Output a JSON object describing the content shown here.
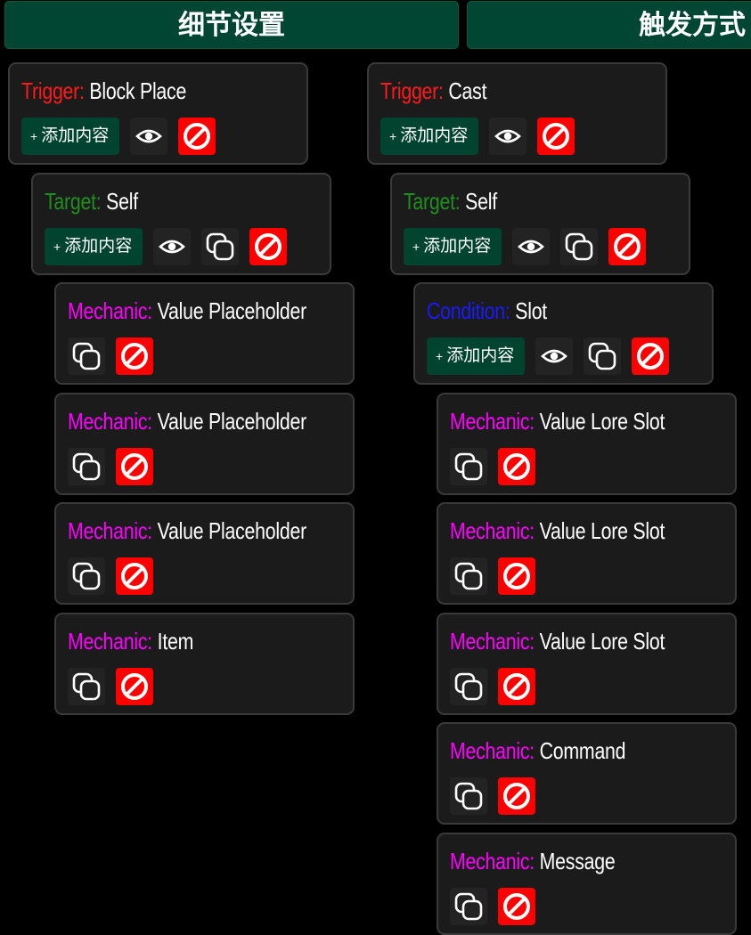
{
  "columns": [
    {
      "title": "细节设置"
    },
    {
      "title": "触发方式"
    }
  ],
  "add_label": "添加内容",
  "add_plus": "+",
  "colors": {
    "header_bg": "#004632",
    "card_bg": "#1b1b1b",
    "trigger": "#ff1a1a",
    "target": "#1f8f1f",
    "mechanic": "#ff00ff",
    "condition": "#1a1aff",
    "delete_bg": "#ff0000"
  },
  "cards": [
    {
      "type": "trigger",
      "label": "Trigger:",
      "value": "Block Place",
      "buttons": [
        "add",
        "eye-icon",
        "delete-icon"
      ]
    },
    {
      "type": "target",
      "label": "Target:",
      "value": "Self",
      "buttons": [
        "add",
        "eye-icon",
        "copy-icon",
        "delete-icon"
      ]
    },
    {
      "type": "mechanic",
      "label": "Mechanic:",
      "value": "Value Placeholder",
      "buttons": [
        "copy-icon",
        "delete-icon"
      ]
    },
    {
      "type": "mechanic",
      "label": "Mechanic:",
      "value": "Value Placeholder",
      "buttons": [
        "copy-icon",
        "delete-icon"
      ]
    },
    {
      "type": "mechanic",
      "label": "Mechanic:",
      "value": "Value Placeholder",
      "buttons": [
        "copy-icon",
        "delete-icon"
      ]
    },
    {
      "type": "mechanic",
      "label": "Mechanic:",
      "value": "Item",
      "buttons": [
        "copy-icon",
        "delete-icon"
      ]
    },
    {
      "type": "trigger",
      "label": "Trigger:",
      "value": "Cast",
      "buttons": [
        "add",
        "eye-icon",
        "delete-icon"
      ]
    },
    {
      "type": "target",
      "label": "Target:",
      "value": "Self",
      "buttons": [
        "add",
        "eye-icon",
        "copy-icon",
        "delete-icon"
      ]
    },
    {
      "type": "condition",
      "label": "Condition:",
      "value": "Slot",
      "buttons": [
        "add",
        "eye-icon",
        "copy-icon",
        "delete-icon"
      ]
    },
    {
      "type": "mechanic",
      "label": "Mechanic:",
      "value": "Value Lore Slot",
      "buttons": [
        "copy-icon",
        "delete-icon"
      ]
    },
    {
      "type": "mechanic",
      "label": "Mechanic:",
      "value": "Value Lore Slot",
      "buttons": [
        "copy-icon",
        "delete-icon"
      ]
    },
    {
      "type": "mechanic",
      "label": "Mechanic:",
      "value": "Value Lore Slot",
      "buttons": [
        "copy-icon",
        "delete-icon"
      ]
    },
    {
      "type": "mechanic",
      "label": "Mechanic:",
      "value": "Command",
      "buttons": [
        "copy-icon",
        "delete-icon"
      ]
    },
    {
      "type": "mechanic",
      "label": "Mechanic:",
      "value": "Message",
      "buttons": [
        "copy-icon",
        "delete-icon"
      ]
    }
  ]
}
